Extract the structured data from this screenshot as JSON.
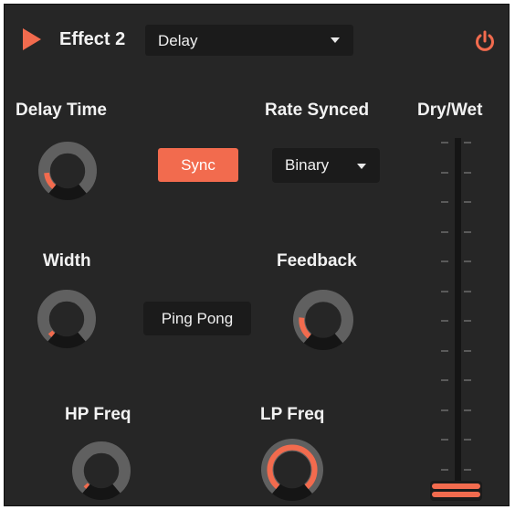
{
  "header": {
    "title": "Effect 2",
    "effect_select_value": "Delay",
    "accent": "#f26b4e"
  },
  "controls": {
    "delay_time": {
      "label": "Delay Time",
      "value_fraction": 0.16
    },
    "sync_button": "Sync",
    "rate_synced": {
      "label": "Rate Synced",
      "value": "Binary"
    },
    "width": {
      "label": "Width",
      "value_fraction": 0.04
    },
    "ping_pong_button": "Ping Pong",
    "feedback": {
      "label": "Feedback",
      "value_fraction": 0.2
    },
    "hp_freq": {
      "label": "HP Freq",
      "value_fraction": 0.03
    },
    "lp_freq": {
      "label": "LP Freq",
      "value_fraction": 1.0
    },
    "dry_wet": {
      "label": "Dry/Wet",
      "value_fraction": 0.0
    }
  },
  "colors": {
    "panel": "#262626",
    "knob_track": "#606060",
    "knob_center": "#262626",
    "accent": "#f26b4e"
  }
}
